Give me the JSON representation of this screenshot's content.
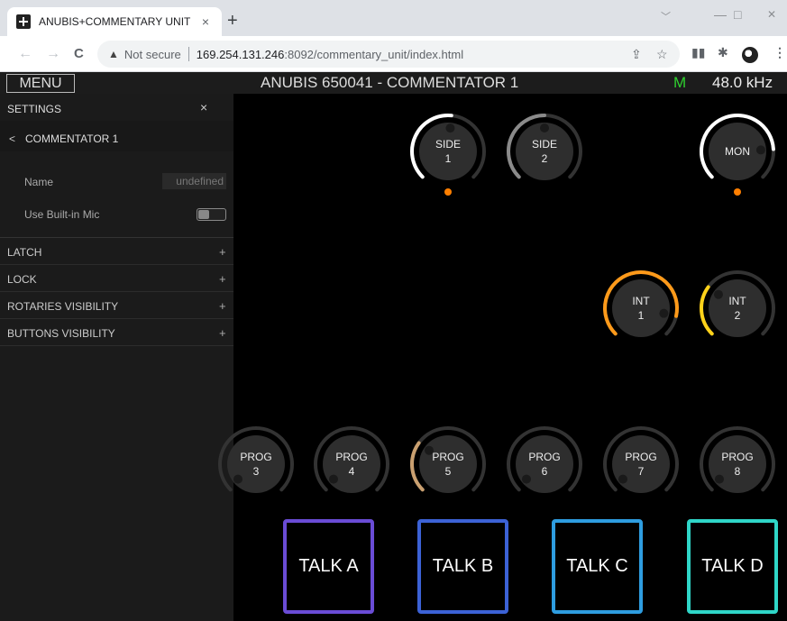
{
  "browser": {
    "tab_title": "ANUBIS+COMMENTARY UNIT",
    "tab_close": "×",
    "new_tab": "+",
    "window_min": "—",
    "window_max": "□",
    "window_close": "✕",
    "back": "←",
    "forward": "→",
    "reload": "C",
    "warning_icon": "▲",
    "not_secure": "Not secure",
    "url_host": "169.254.131.246",
    "url_path": ":8092/commentary_unit/index.html"
  },
  "app": {
    "menu_label": "MENU",
    "title": "ANUBIS 650041 - COMMENTATOR 1",
    "mode_indicator": "M",
    "sample_rate": "48.0 kHz"
  },
  "sidebar": {
    "header": "SETTINGS",
    "close": "×",
    "back_arrow": "<",
    "subheader": "COMMENTATOR 1",
    "name_label": "Name",
    "name_value": "undefined",
    "builtin_mic_label": "Use Built-in Mic",
    "builtin_mic_on": false,
    "sections": [
      {
        "label": "LATCH",
        "icon": "+"
      },
      {
        "label": "LOCK",
        "icon": "+"
      },
      {
        "label": "ROTARIES VISIBILITY",
        "icon": "+"
      },
      {
        "label": "BUTTONS VISIBILITY",
        "icon": "+"
      }
    ]
  },
  "rotaries": [
    {
      "id": "side1",
      "line1": "SIDE",
      "line2": "1",
      "level": 0.52,
      "color": "#ffffff",
      "indicator": true
    },
    {
      "id": "side2",
      "line1": "SIDE",
      "line2": "2",
      "level": 0.5,
      "color": "#8a8a8a",
      "indicator": false
    },
    {
      "id": "mon",
      "line1": "MON",
      "line2": "",
      "level": 0.82,
      "color": "#ffffff",
      "indicator": true
    },
    {
      "id": "int1",
      "line1": "INT",
      "line2": "1",
      "level": 0.88,
      "color": "#ff9a1a",
      "indicator": false
    },
    {
      "id": "int2",
      "line1": "INT",
      "line2": "2",
      "level": 0.3,
      "color": "#ffd21a",
      "indicator": false
    },
    {
      "id": "prog3",
      "line1": "PROG",
      "line2": "3",
      "level": 0.02,
      "color": "#555555",
      "indicator": false
    },
    {
      "id": "prog4",
      "line1": "PROG",
      "line2": "4",
      "level": 0.02,
      "color": "#555555",
      "indicator": false
    },
    {
      "id": "prog5",
      "line1": "PROG",
      "line2": "5",
      "level": 0.3,
      "color": "#caa070",
      "indicator": false
    },
    {
      "id": "prog6",
      "line1": "PROG",
      "line2": "6",
      "level": 0.02,
      "color": "#555555",
      "indicator": false
    },
    {
      "id": "prog7",
      "line1": "PROG",
      "line2": "7",
      "level": 0.02,
      "color": "#555555",
      "indicator": false
    },
    {
      "id": "prog8",
      "line1": "PROG",
      "line2": "8",
      "level": 0.02,
      "color": "#555555",
      "indicator": false
    }
  ],
  "talk_buttons": [
    {
      "label": "TALK A",
      "color": "#6a4cd6"
    },
    {
      "label": "TALK B",
      "color": "#3c62d6"
    },
    {
      "label": "TALK C",
      "color": "#2e9de0"
    },
    {
      "label": "TALK D",
      "color": "#2fd6c8"
    }
  ]
}
